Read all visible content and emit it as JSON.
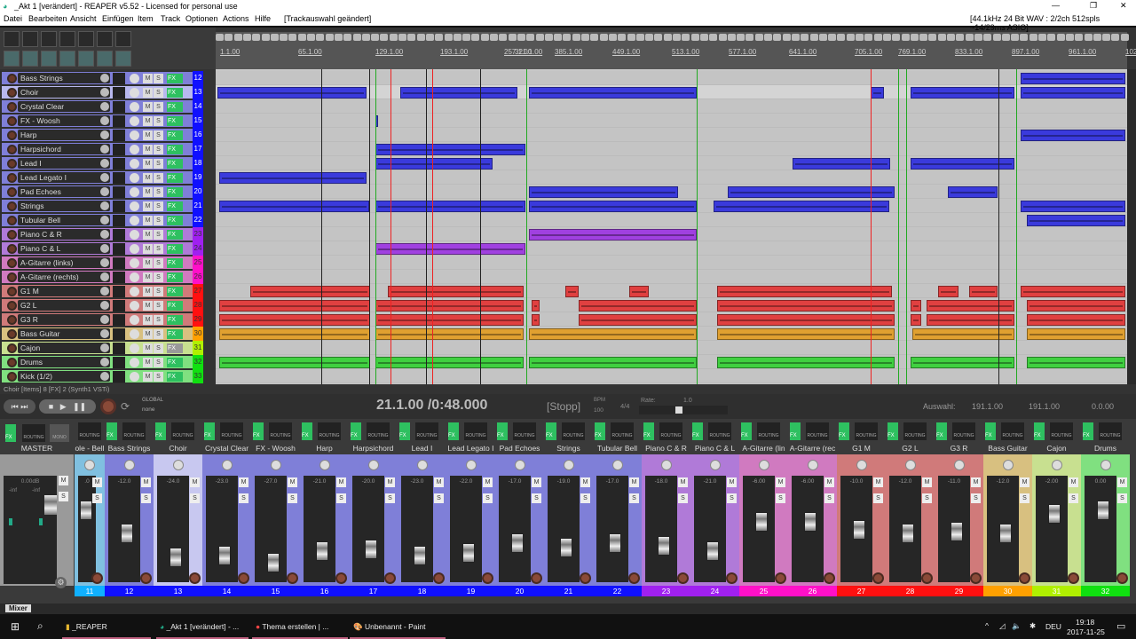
{
  "window": {
    "title": "_Akt 1 [verändert] - REAPER v5.52 - Licensed for personal use",
    "audio_status": "[44.1kHz 24 Bit WAV : 2/2ch 512spls ~14/29ms ASIO]",
    "minimize": "—",
    "maximize": "❐",
    "close": "✕"
  },
  "menu": {
    "items": [
      "Datei",
      "Bearbeiten",
      "Ansicht",
      "Einfügen",
      "Item",
      "Track",
      "Optionen",
      "Actions",
      "Hilfe"
    ],
    "undo_hint": "[Trackauswahl geändert]"
  },
  "ruler": {
    "labels": [
      "1.1.00",
      "65.1.00",
      "129.1.00",
      "193.1.00",
      "257.1.00",
      "321.1.00",
      "385.1.00",
      "449.1.00",
      "513.1.00",
      "577.1.00",
      "641.1.00",
      "705.1.00",
      "769.1.00",
      "833.1.00",
      "897.1.00",
      "961.1.00",
      "1025.1.00"
    ]
  },
  "tracks": [
    {
      "num": "12",
      "name": "Bass Strings",
      "color": "#7f7fd8",
      "num_color": "#1010ff",
      "item_color": "#3a3adc"
    },
    {
      "num": "13",
      "name": "Choir",
      "color": "#b8b8ee",
      "num_color": "#1010ff",
      "item_color": "#3a3adc",
      "selected": true
    },
    {
      "num": "14",
      "name": "Crystal Clear",
      "color": "#7f7fd8",
      "num_color": "#1010ff",
      "item_color": "#3a3adc"
    },
    {
      "num": "15",
      "name": "FX - Woosh",
      "color": "#7f7fd8",
      "num_color": "#1010ff",
      "item_color": "#3a3adc"
    },
    {
      "num": "16",
      "name": "Harp",
      "color": "#7f7fd8",
      "num_color": "#1010ff",
      "item_color": "#3a3adc"
    },
    {
      "num": "17",
      "name": "Harpsichord",
      "color": "#7f7fd8",
      "num_color": "#1010ff",
      "item_color": "#3a3adc"
    },
    {
      "num": "18",
      "name": "Lead I",
      "color": "#7f7fd8",
      "num_color": "#1010ff",
      "item_color": "#3a3adc"
    },
    {
      "num": "19",
      "name": "Lead Legato I",
      "color": "#7f7fd8",
      "num_color": "#1010ff",
      "item_color": "#3a3adc"
    },
    {
      "num": "20",
      "name": "Pad Echoes",
      "color": "#7f7fd8",
      "num_color": "#1010ff",
      "item_color": "#3a3adc"
    },
    {
      "num": "21",
      "name": "Strings",
      "color": "#7f7fd8",
      "num_color": "#1010ff",
      "item_color": "#3a3adc"
    },
    {
      "num": "22",
      "name": "Tubular Bell",
      "color": "#7f7fd8",
      "num_color": "#1010ff",
      "item_color": "#3a3adc"
    },
    {
      "num": "23",
      "name": "Piano C & R",
      "color": "#b07ad8",
      "num_color": "#a020f0",
      "item_color": "#a040e0"
    },
    {
      "num": "24",
      "name": "Piano C & L",
      "color": "#b07ad8",
      "num_color": "#a020f0",
      "item_color": "#a040e0"
    },
    {
      "num": "25",
      "name": "A-Gitarre (links)",
      "color": "#d07ac0",
      "num_color": "#ff10c8",
      "item_color": "#e040c0"
    },
    {
      "num": "26",
      "name": "A-Gitarre (rechts)",
      "color": "#d07ac0",
      "num_color": "#ff10c8",
      "item_color": "#e040c0"
    },
    {
      "num": "27",
      "name": "G1 M",
      "color": "#d07a7a",
      "num_color": "#ff1010",
      "item_color": "#e04040"
    },
    {
      "num": "28",
      "name": "G2 L",
      "color": "#d07a7a",
      "num_color": "#ff1010",
      "item_color": "#e04040"
    },
    {
      "num": "29",
      "name": "G3 R",
      "color": "#d07a7a",
      "num_color": "#ff1010",
      "item_color": "#e04040"
    },
    {
      "num": "30",
      "name": "Bass Guitar",
      "color": "#d8c080",
      "num_color": "#ffa000",
      "item_color": "#e0a030"
    },
    {
      "num": "31",
      "name": "Cajon",
      "color": "#c8e090",
      "num_color": "#b0f000",
      "item_color": "#b0e040",
      "fx_off": true
    },
    {
      "num": "32",
      "name": "Drums",
      "color": "#80e080",
      "num_color": "#10e010",
      "item_color": "#40d040"
    },
    {
      "num": "33",
      "name": "Kick (1/2)",
      "color": "#80e080",
      "num_color": "#10e010",
      "item_color": "#40d040"
    }
  ],
  "track_labels": {
    "mute": "M",
    "solo": "S",
    "fx": "FX"
  },
  "status_line": "Choir [Items] 8 [FX] 2 (Synth1 VSTi)",
  "transport": {
    "global": "GLOBAL",
    "automation": "none",
    "position": "21.1.00 /0:48.000",
    "state": "[Stopp]",
    "bpm_label": "BPM",
    "bpm": "100",
    "time_sig": "4/4",
    "rate_label": "Rate:",
    "rate": "1.0",
    "selection_label": "Auswahl:",
    "sel_start": "191.1.00",
    "sel_end": "191.1.00",
    "sel_length": "0.0.00"
  },
  "mixer": {
    "tab": "Mixer",
    "routing": "ROUTING",
    "mono": "MONO",
    "master": {
      "name": "MASTER",
      "volume": "0.00dB",
      "peak_l": "-inf",
      "peak_r": "-inf"
    },
    "strips": [
      {
        "num": "11",
        "name": "ole - Bell",
        "volume": ".0",
        "color": "#80c0e0",
        "num_color": "#10b0ff"
      },
      {
        "num": "12",
        "name": "Bass Strings",
        "volume": "-12.0",
        "color": "#7f7fd8",
        "num_color": "#1010ff"
      },
      {
        "num": "13",
        "name": "Choir",
        "volume": "-24.0",
        "color": "#c8c8f0",
        "num_color": "#1010ff"
      },
      {
        "num": "14",
        "name": "Crystal Clear",
        "volume": "-23.0",
        "color": "#7f7fd8",
        "num_color": "#1010ff"
      },
      {
        "num": "15",
        "name": "FX - Woosh",
        "volume": "-27.0",
        "color": "#7f7fd8",
        "num_color": "#1010ff"
      },
      {
        "num": "16",
        "name": "Harp",
        "volume": "-21.0",
        "color": "#7f7fd8",
        "num_color": "#1010ff"
      },
      {
        "num": "17",
        "name": "Harpsichord",
        "volume": "-20.0",
        "color": "#7f7fd8",
        "num_color": "#1010ff"
      },
      {
        "num": "18",
        "name": "Lead I",
        "volume": "-23.0",
        "color": "#7f7fd8",
        "num_color": "#1010ff"
      },
      {
        "num": "19",
        "name": "Lead Legato I",
        "volume": "-22.0",
        "color": "#7f7fd8",
        "num_color": "#1010ff"
      },
      {
        "num": "20",
        "name": "Pad Echoes",
        "volume": "-17.0",
        "color": "#7f7fd8",
        "num_color": "#1010ff"
      },
      {
        "num": "21",
        "name": "Strings",
        "volume": "-19.0",
        "color": "#7f7fd8",
        "num_color": "#1010ff"
      },
      {
        "num": "22",
        "name": "Tubular Bell",
        "volume": "-17.0",
        "color": "#7f7fd8",
        "num_color": "#1010ff"
      },
      {
        "num": "23",
        "name": "Piano C & R",
        "volume": "-18.0",
        "color": "#b07ad8",
        "num_color": "#a020f0"
      },
      {
        "num": "24",
        "name": "Piano C & L",
        "volume": "-21.0",
        "color": "#b07ad8",
        "num_color": "#a020f0"
      },
      {
        "num": "25",
        "name": "A-Gitarre (lin",
        "volume": "-6.00",
        "color": "#d07ac0",
        "num_color": "#ff10c8"
      },
      {
        "num": "26",
        "name": "A-Gitarre (rec",
        "volume": "-6.00",
        "color": "#d07ac0",
        "num_color": "#ff10c8"
      },
      {
        "num": "27",
        "name": "G1 M",
        "volume": "-10.0",
        "color": "#d07a7a",
        "num_color": "#ff1010"
      },
      {
        "num": "28",
        "name": "G2 L",
        "volume": "-12.0",
        "color": "#d07a7a",
        "num_color": "#ff1010"
      },
      {
        "num": "29",
        "name": "G3 R",
        "volume": "-11.0",
        "color": "#d07a7a",
        "num_color": "#ff1010"
      },
      {
        "num": "30",
        "name": "Bass Guitar",
        "volume": "-12.0",
        "color": "#d8c080",
        "num_color": "#ffa000"
      },
      {
        "num": "31",
        "name": "Cajon",
        "volume": "-2.00",
        "color": "#c8e090",
        "num_color": "#b0f000"
      },
      {
        "num": "32",
        "name": "Drums",
        "volume": "0.00",
        "color": "#80e080",
        "num_color": "#10e010"
      }
    ]
  },
  "taskbar": {
    "items": [
      "_REAPER",
      "_Akt 1 [verändert] - ...",
      "Thema erstellen | ...",
      "Unbenannt - Paint"
    ],
    "language": "DEU",
    "time": "19:18",
    "date": "2017-11-25"
  }
}
